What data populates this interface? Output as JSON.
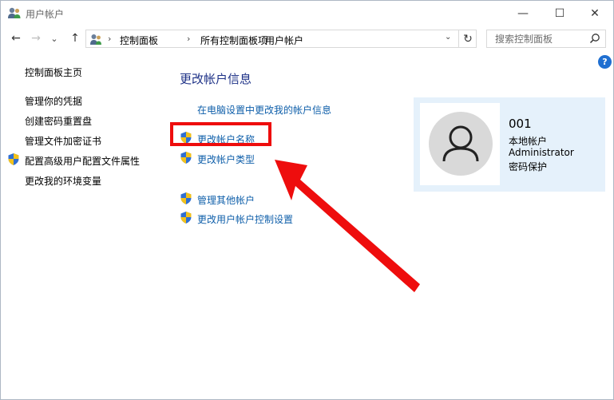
{
  "window": {
    "title": "用户帐户",
    "controls": {
      "minimize": "—",
      "maximize": "☐",
      "close": "✕"
    }
  },
  "navigation": {
    "back": "←",
    "forward": "→",
    "dropdown": "⌄",
    "up": "↑",
    "breadcrumb": [
      "控制面板",
      "所有控制面板项",
      "用户帐户"
    ],
    "separator": "›",
    "address_dropdown": "⌄",
    "refresh": "↻",
    "search_placeholder": "搜索控制面板",
    "help": "?"
  },
  "sidebar": {
    "home": "控制面板主页",
    "items": [
      "管理你的凭据",
      "创建密码重置盘",
      "管理文件加密证书",
      "配置高级用户配置文件属性",
      "更改我的环境变量"
    ]
  },
  "main": {
    "heading": "更改帐户信息",
    "pc_settings_link": "在电脑设置中更改我的帐户信息",
    "change_name": "更改帐户名称",
    "change_type": "更改帐户类型",
    "manage_other": "管理其他帐户",
    "uac_settings": "更改用户帐户控制设置"
  },
  "account": {
    "name": "001",
    "type": "本地帐户",
    "role": "Administrator",
    "protection": "密码保护"
  },
  "colors": {
    "annotation_red": "#ee0d0d",
    "link_blue": "#0f5faa",
    "heading_blue": "#1e3287",
    "card_bg": "#e5f1fb"
  }
}
